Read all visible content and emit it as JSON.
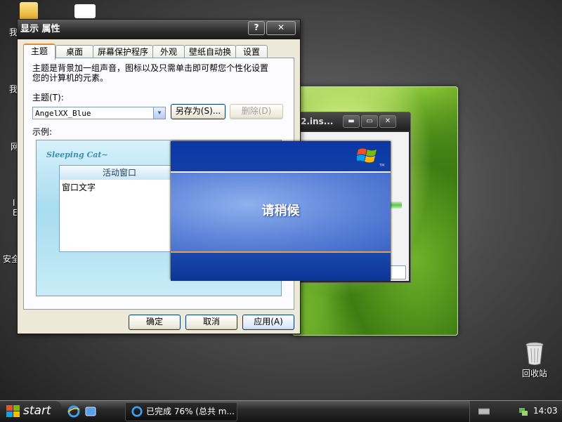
{
  "desktop": {
    "left_icon_labels": [
      "我",
      "我",
      "网",
      "I E",
      "安全"
    ],
    "recycle_bin_label": "回收站"
  },
  "installer_window": {
    "title": "2.ins...",
    "min_button": "▬",
    "max_button": "▭",
    "close_button": "✕"
  },
  "dialog": {
    "title": "显示 属性",
    "help_button": "?",
    "close_button": "✕",
    "tabs": [
      {
        "label": "主题",
        "active": true
      },
      {
        "label": "桌面",
        "active": false
      },
      {
        "label": "屏幕保护程序",
        "active": false
      },
      {
        "label": "外观",
        "active": false
      },
      {
        "label": "壁纸自动换",
        "active": false
      },
      {
        "label": "设置",
        "active": false
      }
    ],
    "description_line1": "主题是背景加一组声音，图标以及只需单击即可帮您个性化设置",
    "description_line2": "您的计算机的元素。",
    "theme_label": "主题(T):",
    "theme_value": "AngelXX_Blue",
    "save_as_button": "另存为(S)...",
    "delete_button": "删除(D)",
    "sample_label": "示例:",
    "preview": {
      "logo_text": "Sleeping Cat~",
      "active_window_title": "活动窗口",
      "window_text": "窗口文字"
    },
    "ok_button": "确定",
    "cancel_button": "取消",
    "apply_button": "应用(A)"
  },
  "splash": {
    "message": "请稍候",
    "tm": "TM"
  },
  "taskbar": {
    "start_label": "start",
    "task_item_label": "已完成 76% (总共 m...",
    "clock": "14:03"
  },
  "colors": {
    "dialog_bg": "#ece9d8",
    "splash_blue": "#0f3a9c",
    "tab_highlight": "#e68b2c"
  },
  "icons": [
    "folder-icon",
    "ebay-icon",
    "internet-explorer-icon",
    "recycle-bin-icon",
    "windows-logo-icon",
    "network-tray-icon",
    "keyboard-tray-icon"
  ]
}
